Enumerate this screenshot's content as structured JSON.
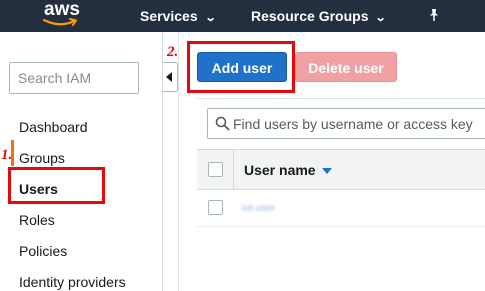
{
  "topbar": {
    "logo_text": "aws",
    "services_label": "Services",
    "resource_groups_label": "Resource Groups",
    "chevron": "⌄",
    "pin_icon": "pin-icon"
  },
  "sidebar": {
    "search_placeholder": "Search IAM",
    "items": [
      {
        "label": "Dashboard",
        "active": false
      },
      {
        "label": "Groups",
        "active": false
      },
      {
        "label": "Users",
        "active": true
      },
      {
        "label": "Roles",
        "active": false
      },
      {
        "label": "Policies",
        "active": false
      },
      {
        "label": "Identity providers",
        "active": false
      }
    ]
  },
  "toolbar": {
    "add_user_label": "Add user",
    "delete_user_label": "Delete user"
  },
  "filter": {
    "placeholder": "Find users by username or access key"
  },
  "table": {
    "columns": [
      {
        "label": "User name",
        "sorted": "descending"
      }
    ],
    "rows": [
      {
        "user_name": "iot-user"
      }
    ]
  },
  "annotations": [
    {
      "number": "1.",
      "target": "Users"
    },
    {
      "number": "2.",
      "target": "Add user"
    }
  ],
  "colors": {
    "nav_bg": "#232f3e",
    "primary": "#1f71c9",
    "danger_disabled": "#f1a1a3",
    "annotation": "#e8080b",
    "active_indicator": "#ec7211"
  }
}
